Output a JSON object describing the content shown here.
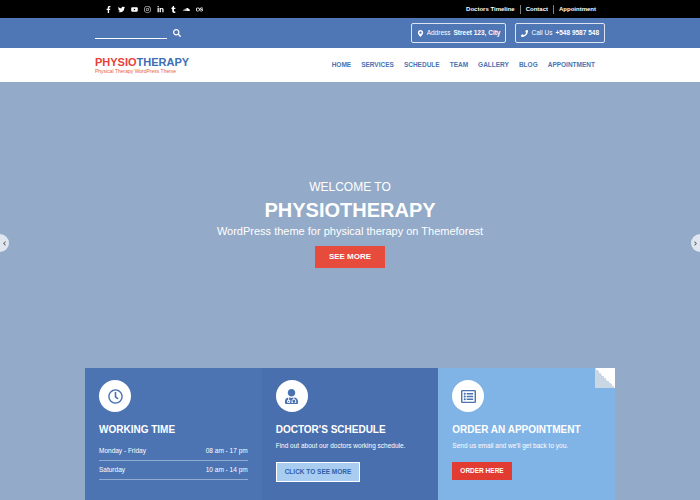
{
  "top_bar": {
    "links": [
      "Doctors Timeline",
      "Contact",
      "Appointment"
    ]
  },
  "header": {
    "address": {
      "label": "Address",
      "value": "Street 123, City"
    },
    "phone": {
      "label": "Call Us",
      "value": "+548 9587 548"
    }
  },
  "logo": {
    "first": "PHYSIO",
    "second": "THERAPY",
    "tagline": "Physical Therapy WordPress Theme"
  },
  "nav": {
    "items": [
      "HOME",
      "SERVICES",
      "SCHEDULE",
      "TEAM",
      "GALLERY",
      "BLOG",
      "APPOINTMENT"
    ]
  },
  "hero": {
    "kicker": "WELCOME TO",
    "title": "PHYSIOTHERAPY",
    "subtitle": "WordPress theme for physical therapy on Themeforest",
    "button": "SEE MORE"
  },
  "cards": [
    {
      "kind": "hours",
      "title": "WORKING TIME",
      "rows": [
        {
          "day": "Monday - Friday",
          "time": "08 am - 17 pm"
        },
        {
          "day": "Saturday",
          "time": "10 am - 14 pm"
        }
      ]
    },
    {
      "kind": "action",
      "title": "DOCTOR'S SCHEDULE",
      "text": "Find out about our doctors working schedule.",
      "button": "CLICK TO SEE MORE"
    },
    {
      "kind": "action",
      "title": "ORDER AN APPOINTMENT",
      "text": "Send us email and we'll get back to you.",
      "button": "ORDER HERE"
    }
  ]
}
